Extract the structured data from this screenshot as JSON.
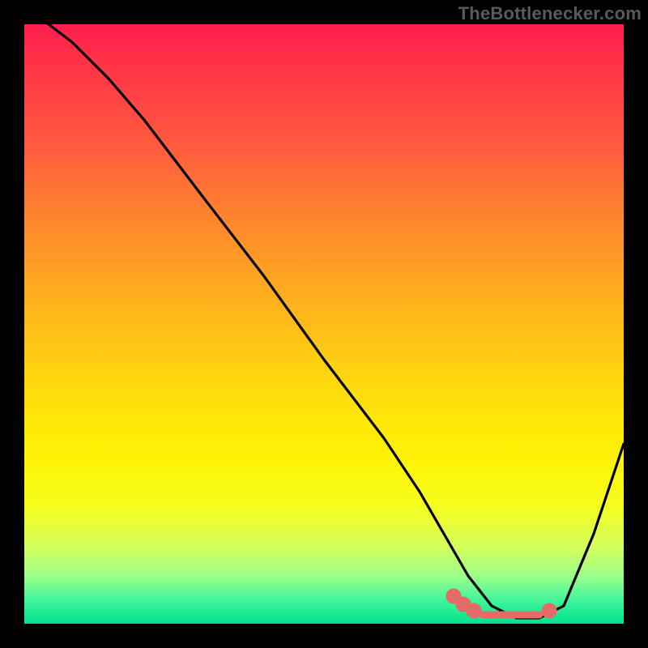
{
  "watermark_text": "TheBottlenecker.com",
  "chart_data": {
    "type": "line",
    "title": "",
    "xlabel": "",
    "ylabel": "",
    "xlim": [
      0,
      100
    ],
    "ylim": [
      0,
      100
    ],
    "x": [
      0,
      4,
      8,
      10,
      14,
      20,
      30,
      40,
      50,
      60,
      66,
      70,
      74,
      78,
      82,
      86,
      90,
      95,
      100
    ],
    "values": [
      104,
      100,
      97,
      95,
      91,
      84,
      71,
      58,
      44,
      31,
      22,
      15,
      8,
      3,
      1,
      1,
      3,
      15,
      30
    ],
    "note": "Values are approximate percentages read visually (y=0 is bottom green band, y=100 is top red band). Short pink marker segment along the valley floor roughly spans x≈72–86 at y≈1–3."
  },
  "colors": {
    "curve": "#000000",
    "marker": "#e86a66",
    "frame": "#000000"
  }
}
